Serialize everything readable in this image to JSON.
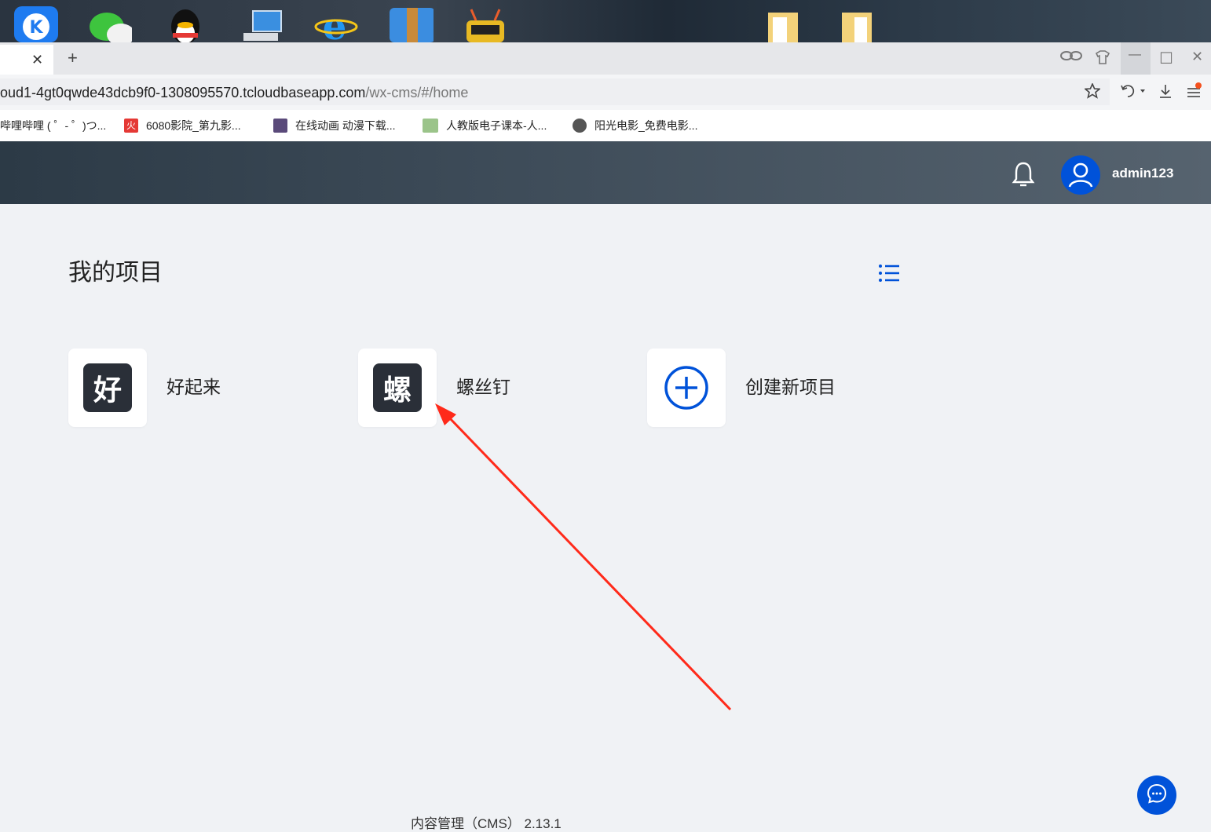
{
  "desktop": {
    "icons": [
      "kugou-icon",
      "wechat-icon",
      "qq-penguin-icon",
      "computer-icon",
      "ie-browser-icon",
      "archive-icon",
      "robot-icon",
      "folder-icon",
      "folder-icon"
    ]
  },
  "browser": {
    "tab": {
      "close_symbol": "✕",
      "new_tab_symbol": "+"
    },
    "window_controls": {
      "minimize": "—",
      "maximize": "☐",
      "close": "✕"
    },
    "url": {
      "host": "oud1-4gt0qwde43dcb9f0-1308095570.tcloudbaseapp.com",
      "path": "/wx-cms/#/home"
    },
    "bookmarks": [
      {
        "label": "哔哩哔哩 ( ゜- ゜)つ...",
        "icon": "bilibili-icon"
      },
      {
        "label": "6080影院_第九影...",
        "icon": "fire-icon"
      },
      {
        "label": "在线动画 动漫下载...",
        "icon": "anime-icon"
      },
      {
        "label": "人教版电子课本-人...",
        "icon": "book-icon"
      },
      {
        "label": "阳光电影_免费电影...",
        "icon": "movie-icon"
      }
    ]
  },
  "header": {
    "username": "admin123"
  },
  "main": {
    "title": "我的项目",
    "projects": [
      {
        "badge": "好",
        "name": "好起来"
      },
      {
        "badge": "螺",
        "name": "螺丝钉"
      }
    ],
    "create_label": "创建新项目"
  },
  "footer": {
    "text": "内容管理（CMS） 2.13.1"
  },
  "colors": {
    "primary": "#0052d9",
    "header_dark": "#2c3a46",
    "badge_bg": "#2a2f38",
    "page_bg": "#f0f2f5",
    "annotation_arrow": "#ff2a1a"
  }
}
